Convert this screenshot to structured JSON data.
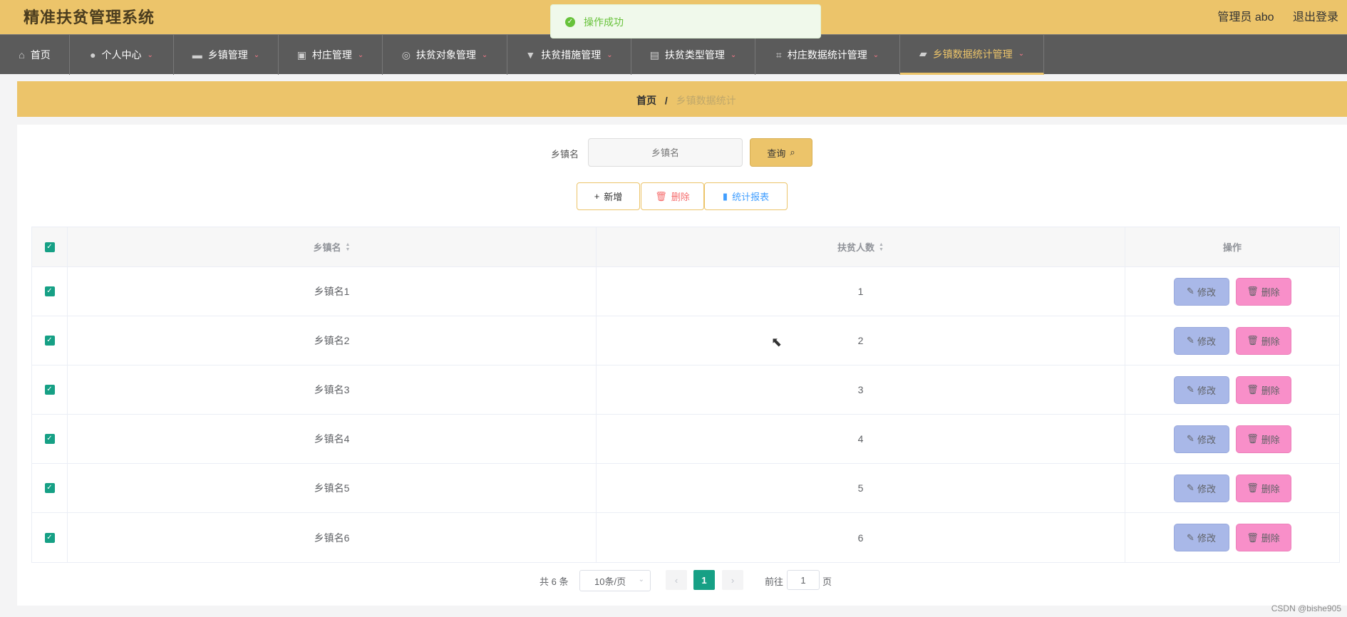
{
  "header": {
    "title": "精准扶贫管理系统",
    "user": "管理员 abo",
    "logout": "退出登录"
  },
  "toast": {
    "text": "操作成功"
  },
  "nav": [
    {
      "label": "首页",
      "icon": "home-icon"
    },
    {
      "label": "个人中心",
      "icon": "user-icon"
    },
    {
      "label": "乡镇管理",
      "icon": "monitor-icon"
    },
    {
      "label": "村庄管理",
      "icon": "briefcase-icon"
    },
    {
      "label": "扶贫对象管理",
      "icon": "compass-icon"
    },
    {
      "label": "扶贫措施管理",
      "icon": "flag-icon"
    },
    {
      "label": "扶贫类型管理",
      "icon": "clipboard-icon"
    },
    {
      "label": "村庄数据统计管理",
      "icon": "crop-icon"
    },
    {
      "label": "乡镇数据统计管理",
      "icon": "ticket-icon"
    }
  ],
  "breadcrumb": {
    "home": "首页",
    "separator": "/",
    "current": "乡镇数据统计"
  },
  "search": {
    "label": "乡镇名",
    "placeholder": "乡镇名",
    "button": "查询"
  },
  "actions": {
    "add": "新增",
    "delete": "删除",
    "report": "统计报表"
  },
  "table": {
    "headers": {
      "name": "乡镇名",
      "count": "扶贫人数",
      "ops": "操作"
    },
    "rows": [
      {
        "name": "乡镇名1",
        "count": "1"
      },
      {
        "name": "乡镇名2",
        "count": "2"
      },
      {
        "name": "乡镇名3",
        "count": "3"
      },
      {
        "name": "乡镇名4",
        "count": "4"
      },
      {
        "name": "乡镇名5",
        "count": "5"
      },
      {
        "name": "乡镇名6",
        "count": "6"
      }
    ],
    "edit_label": "修改",
    "delete_label": "删除"
  },
  "pagination": {
    "total": "共 6 条",
    "page_size": "10条/页",
    "current": "1",
    "goto": "前往",
    "jump_value": "1",
    "page_suffix": "页"
  },
  "watermark": "CSDN @bishe905",
  "colors": {
    "accent": "#ecc46a",
    "nav_bg": "#5b5b5b",
    "check": "#16a085",
    "edit": "#a9b8e8",
    "delete": "#f88fc9"
  }
}
